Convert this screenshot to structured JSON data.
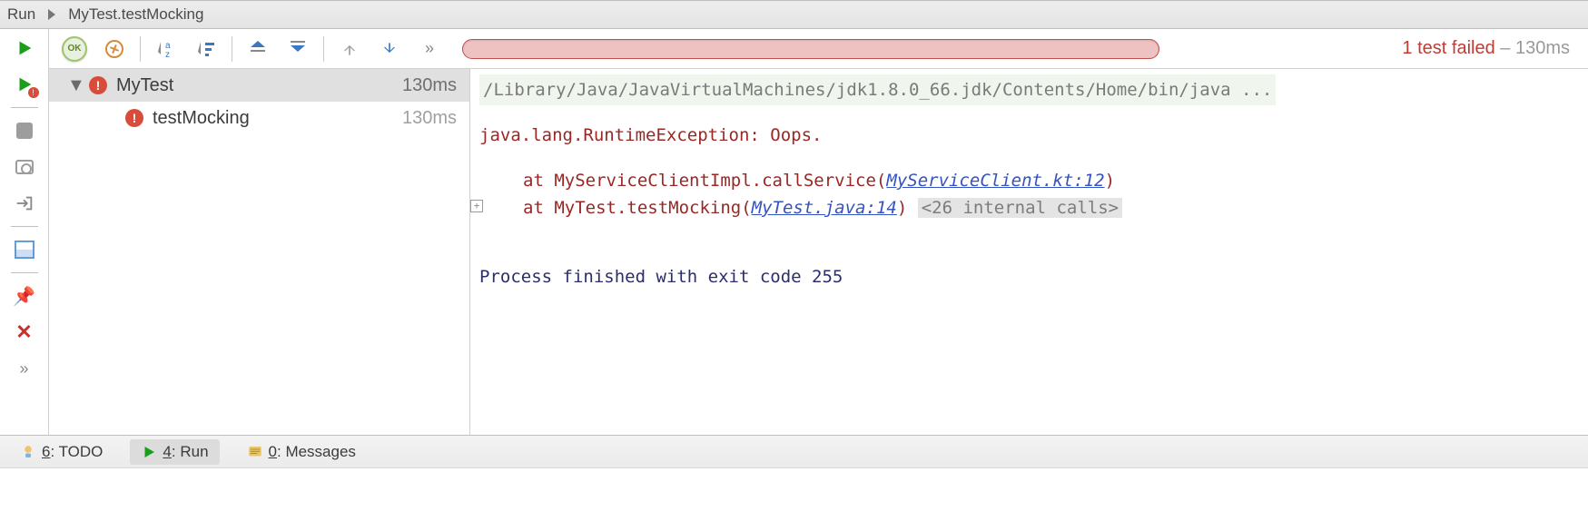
{
  "header": {
    "tool_window_name": "Run",
    "config_name": "MyTest.testMocking"
  },
  "toolbar": {
    "ok_label": "OK",
    "status_failed": "1 test failed",
    "status_sep": " – ",
    "status_duration": "130ms"
  },
  "tree": {
    "root": {
      "name": "MyTest",
      "duration": "130ms"
    },
    "child": {
      "name": "testMocking",
      "duration": "130ms"
    }
  },
  "console": {
    "command": "/Library/Java/JavaVirtualMachines/jdk1.8.0_66.jdk/Contents/Home/bin/java ...",
    "exception": "java.lang.RuntimeException: Oops.",
    "frame1_prefix": "at MyServiceClientImpl.callService(",
    "frame1_link": "MyServiceClient.kt:12",
    "frame1_suffix": ")",
    "frame2_prefix": "at MyTest.testMocking(",
    "frame2_link": "MyTest.java:14",
    "frame2_suffix": ")",
    "frame2_internal": "<26 internal calls>",
    "exit_message": "Process finished with exit code 255"
  },
  "bottom_tabs": {
    "todo": {
      "key": "6",
      "label": ": TODO"
    },
    "run": {
      "key": "4",
      "label": ": Run"
    },
    "messages": {
      "key": "0",
      "label": ": Messages"
    }
  }
}
